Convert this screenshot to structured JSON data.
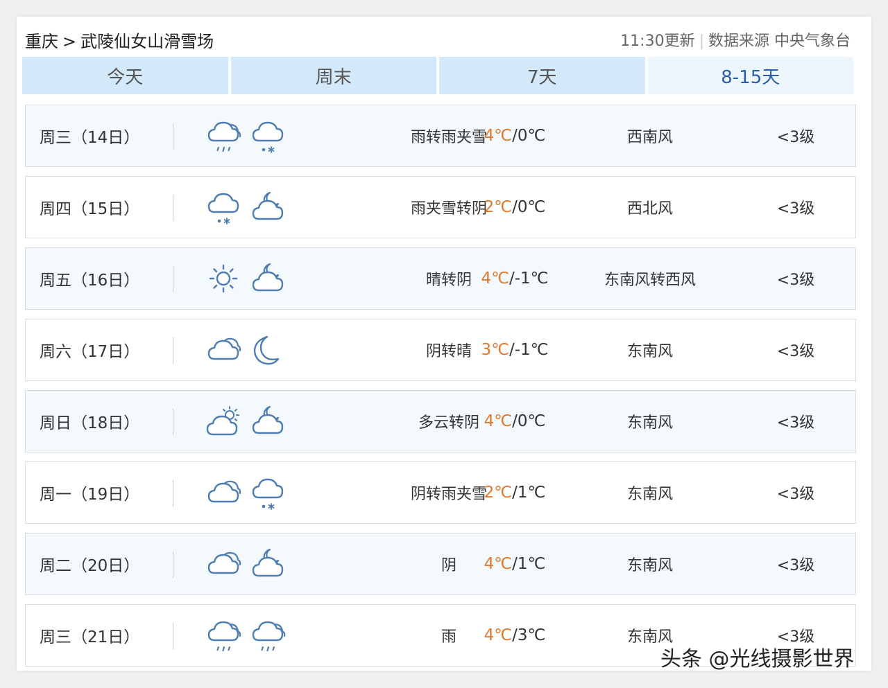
{
  "header": {
    "location": "重庆",
    "separator": ">",
    "place": "武陵仙女山滑雪场",
    "update": "11:30更新",
    "source": "数据来源 中央气象台"
  },
  "tabs": [
    {
      "label": "今天"
    },
    {
      "label": "周末"
    },
    {
      "label": "7天"
    },
    {
      "label": "8-15天",
      "active": true
    }
  ],
  "forecast": [
    {
      "day": "周三（14日）",
      "icon1": "cloud-rain-icon",
      "icon2": "cloud-sleet-icon",
      "desc": "雨转雨夹雪",
      "high": "4℃",
      "low": "0℃",
      "wind": "西南风",
      "level": "<3级"
    },
    {
      "day": "周四（15日）",
      "icon1": "cloud-sleet-icon",
      "icon2": "cloud-moon-icon",
      "desc": "雨夹雪转阴",
      "high": "2℃",
      "low": "0℃",
      "wind": "西北风",
      "level": "<3级"
    },
    {
      "day": "周五（16日）",
      "icon1": "sun-icon",
      "icon2": "cloud-moon-icon",
      "desc": "晴转阴",
      "high": "4℃",
      "low": "-1℃",
      "wind": "东南风转西风",
      "level": "<3级"
    },
    {
      "day": "周六（17日）",
      "icon1": "cloud-icon",
      "icon2": "moon-icon",
      "desc": "阴转晴",
      "high": "3℃",
      "low": "-1℃",
      "wind": "东南风",
      "level": "<3级"
    },
    {
      "day": "周日（18日）",
      "icon1": "cloud-sun-icon",
      "icon2": "cloud-moon-icon",
      "desc": "多云转阴",
      "high": "4℃",
      "low": "0℃",
      "wind": "东南风",
      "level": "<3级"
    },
    {
      "day": "周一（19日）",
      "icon1": "cloud-icon",
      "icon2": "cloud-sleet-icon",
      "desc": "阴转雨夹雪",
      "high": "2℃",
      "low": "1℃",
      "wind": "东南风",
      "level": "<3级"
    },
    {
      "day": "周二（20日）",
      "icon1": "cloud-icon",
      "icon2": "cloud-moon-icon",
      "desc": "阴",
      "high": "4℃",
      "low": "1℃",
      "wind": "东南风",
      "level": "<3级"
    },
    {
      "day": "周三（21日）",
      "icon1": "cloud-rain-icon",
      "icon2": "cloud-rain-icon",
      "desc": "雨",
      "high": "4℃",
      "low": "3℃",
      "wind": "东南风",
      "level": "<3级"
    }
  ],
  "watermark": "头条 @光线摄影世界",
  "colors": {
    "high_temp": "#e0782a",
    "tab_bg": "#d3e8f8",
    "tab_active_text": "#2b5ea8",
    "icon_stroke": "#4d7db3"
  }
}
